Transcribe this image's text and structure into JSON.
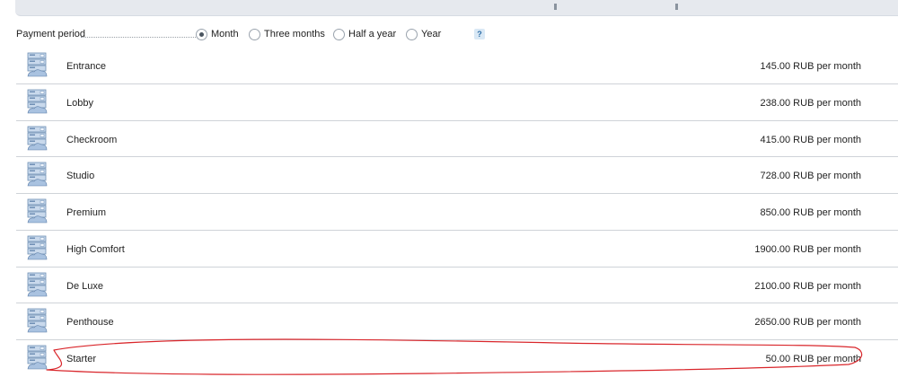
{
  "payment_period": {
    "label": "Payment period",
    "options": [
      {
        "label": "Month",
        "selected": true
      },
      {
        "label": "Three months",
        "selected": false
      },
      {
        "label": "Half a year",
        "selected": false
      },
      {
        "label": "Year",
        "selected": false
      }
    ],
    "help": "?"
  },
  "plans": [
    {
      "name": "Entrance",
      "price": "145.00 RUB per month"
    },
    {
      "name": "Lobby",
      "price": "238.00 RUB per month"
    },
    {
      "name": "Checkroom",
      "price": "415.00 RUB per month"
    },
    {
      "name": "Studio",
      "price": "728.00 RUB per month"
    },
    {
      "name": "Premium",
      "price": "850.00 RUB per month"
    },
    {
      "name": "High Comfort",
      "price": "1900.00 RUB per month"
    },
    {
      "name": "De Luxe",
      "price": "2100.00 RUB per month"
    },
    {
      "name": "Penthouse",
      "price": "2650.00 RUB per month"
    },
    {
      "name": "Starter",
      "price": "50.00 RUB per month"
    }
  ],
  "icons": {
    "plan": "server-plan-icon",
    "help": "help-icon"
  },
  "colors": {
    "annotation": "#d9262b",
    "top_panel": "#e6e9ee",
    "divider": "#cfd3d8"
  }
}
